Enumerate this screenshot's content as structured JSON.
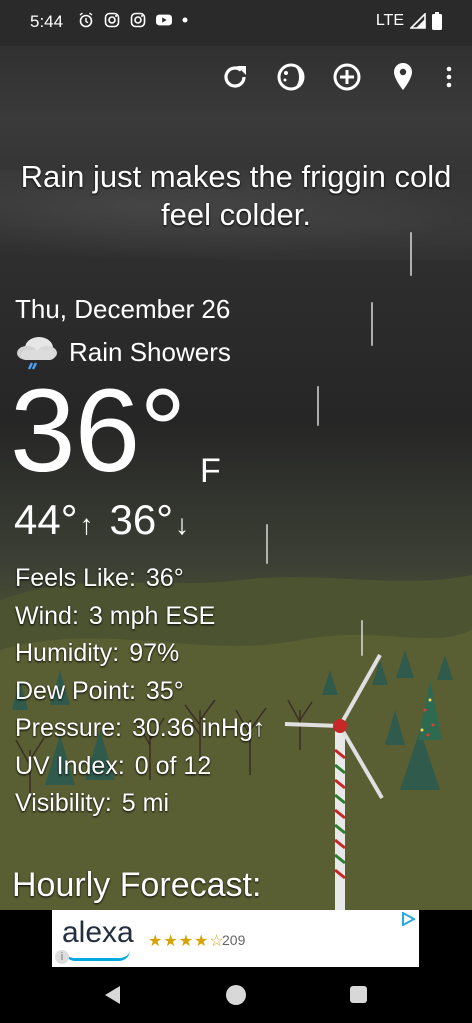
{
  "status": {
    "time": "5:44",
    "network": "LTE",
    "notification_icons": [
      "alarm-icon",
      "instagram-icon",
      "instagram-icon",
      "youtube-icon",
      "dot-icon"
    ]
  },
  "toolbar": {
    "icons": [
      "refresh-icon",
      "moon-phase-icon",
      "add-location-icon",
      "location-pin-icon",
      "more-vert-icon"
    ]
  },
  "quote": "Rain just makes the friggin cold feel colder.",
  "weather": {
    "date": "Thu, December 26",
    "condition": "Rain Showers",
    "condition_icon": "rain-cloud-icon",
    "temperature": "36°",
    "unit": "F",
    "high": "44°",
    "low": "36°",
    "up_arrow": "↑",
    "down_arrow": "↓"
  },
  "details": [
    {
      "label": "Feels Like:",
      "value": "36°"
    },
    {
      "label": "Wind:",
      "value": "3 mph ESE"
    },
    {
      "label": "Humidity:",
      "value": "97%"
    },
    {
      "label": "Dew Point:",
      "value": "35°"
    },
    {
      "label": "Pressure:",
      "value": "30.36 inHg↑"
    },
    {
      "label": "UV Index:",
      "value": "0 of 12"
    },
    {
      "label": "Visibility:",
      "value": "5 mi"
    }
  ],
  "hourly_title": "Hourly Forecast:",
  "ad": {
    "brand": "alexa",
    "stars": "★★★★☆",
    "rating_count": "209",
    "info": "i"
  },
  "colors": {
    "accent_ad_smile": "#00a8e1",
    "stars": "#d6a400"
  }
}
